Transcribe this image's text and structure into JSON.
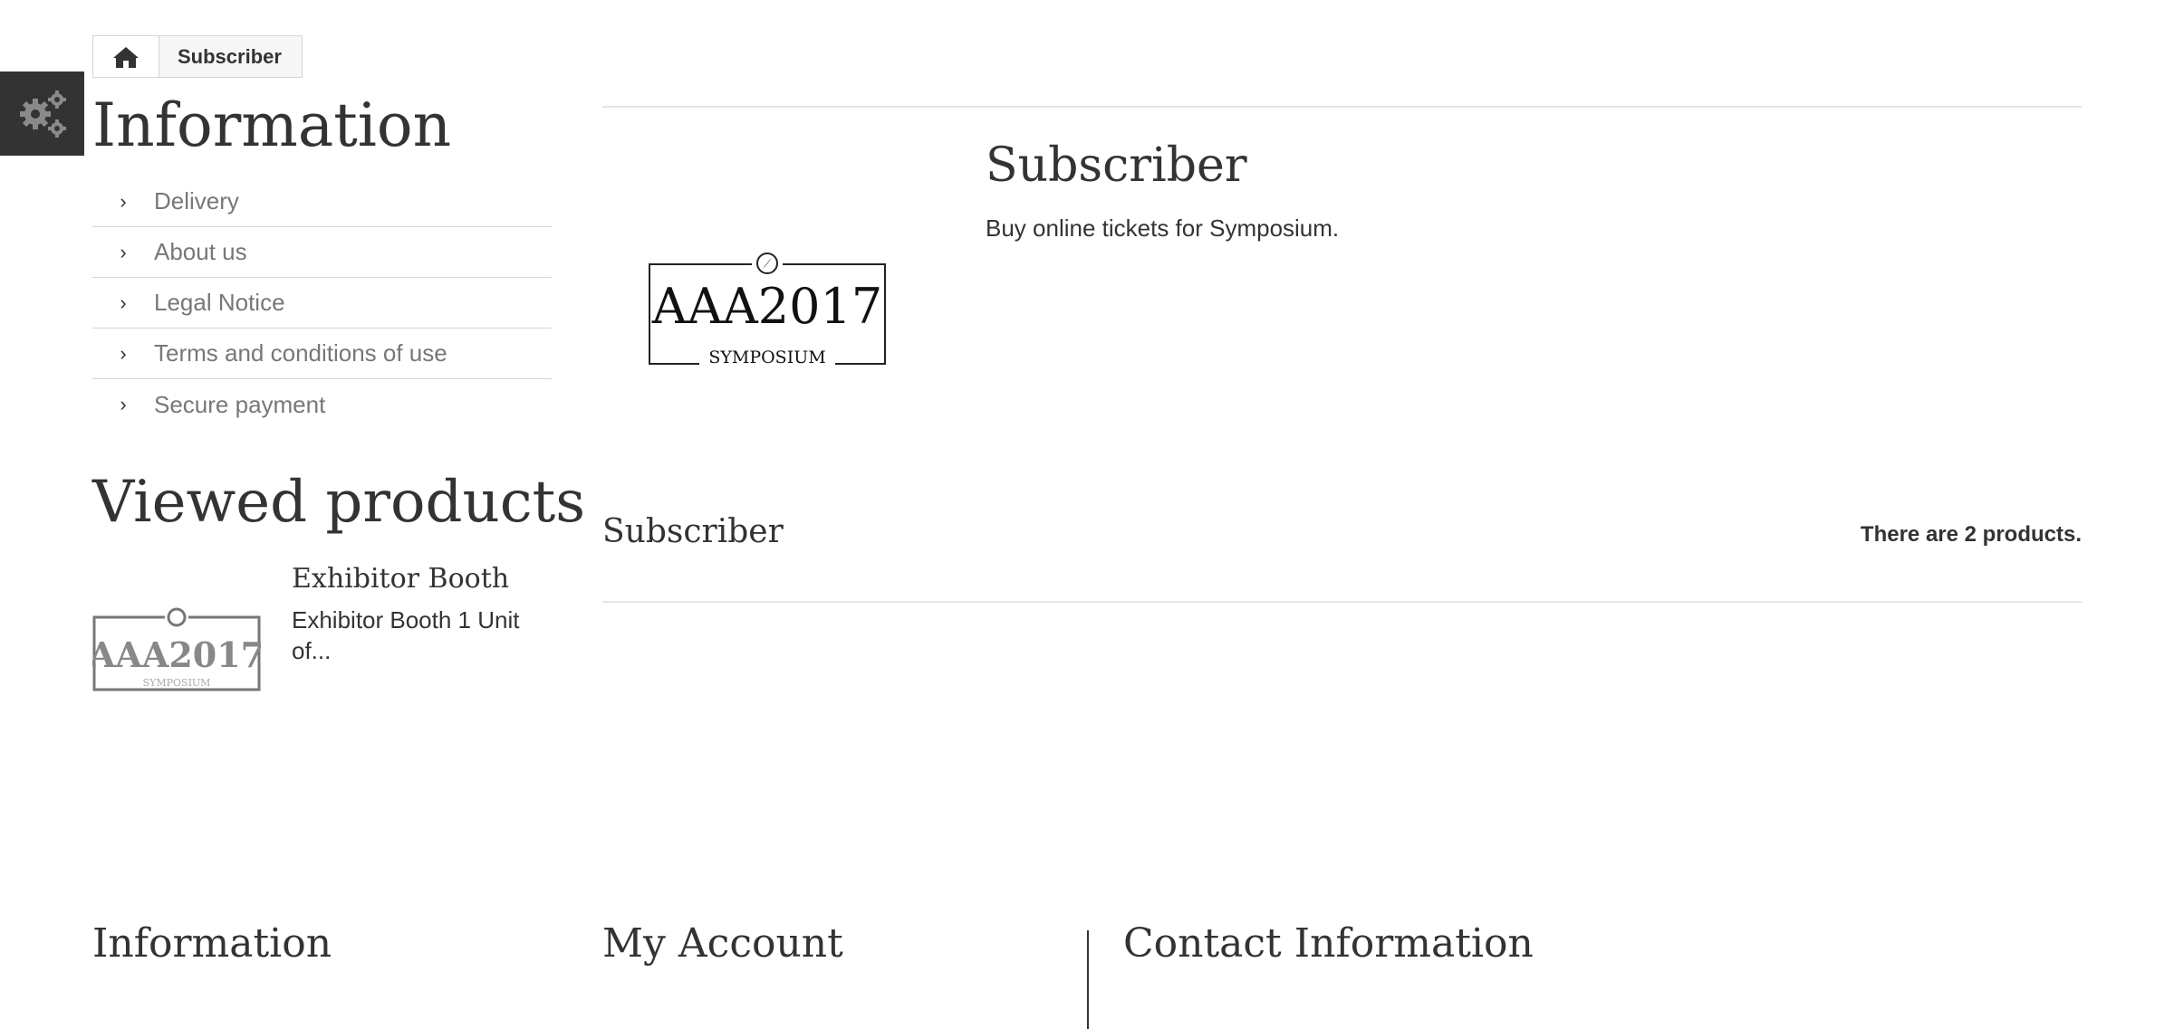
{
  "breadcrumb": {
    "home_icon": "home-icon",
    "current": "Subscriber"
  },
  "toolbar": {
    "gear_icon": "gears-icon"
  },
  "sidebar": {
    "information_title": "Information",
    "links": [
      {
        "label": "Delivery"
      },
      {
        "label": "About us"
      },
      {
        "label": "Legal Notice"
      },
      {
        "label": "Terms and conditions of use"
      },
      {
        "label": "Secure payment"
      }
    ],
    "viewed_title": "Viewed products",
    "viewed_product": {
      "name": "Exhibitor Booth",
      "description": "Exhibitor Booth 1 Unit of..."
    }
  },
  "category": {
    "logo_text": "AAA2017",
    "logo_subtext": "SYMPOSIUM",
    "title": "Subscriber",
    "description": "Buy online tickets for Symposium.",
    "heading": "Subscriber",
    "product_count": "There are 2 products."
  },
  "footer": {
    "information": "Information",
    "my_account": "My Account",
    "contact": "Contact Information"
  },
  "colors": {
    "dark": "#333333",
    "muted": "#777777",
    "border": "#d6d4d4"
  }
}
